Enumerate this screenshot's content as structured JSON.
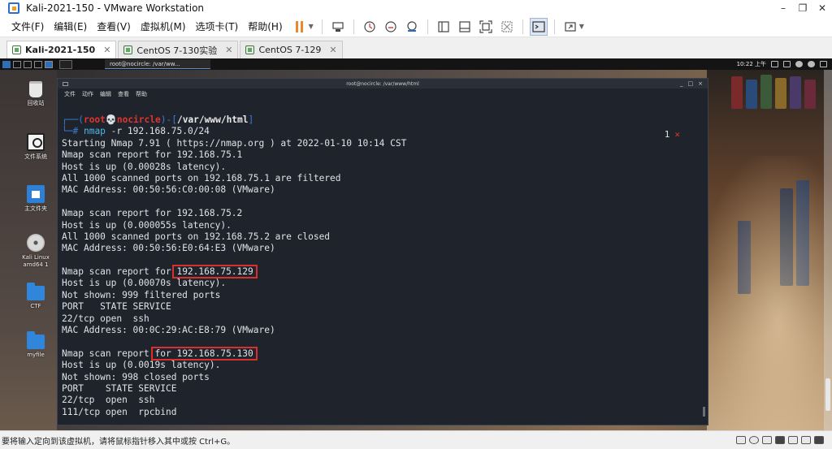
{
  "window": {
    "title": "Kali-2021-150 - VMware Workstation",
    "minimize": "–",
    "restore": "❐",
    "close": "✕"
  },
  "menu": {
    "items": [
      "文件(F)",
      "编辑(E)",
      "查看(V)",
      "虚拟机(M)",
      "选项卡(T)",
      "帮助(H)"
    ]
  },
  "toolbar": {
    "icons": [
      "pause-icon",
      "send-ctrl-alt-del-icon",
      "snapshot-icon",
      "revert-snapshot-icon",
      "snapshot-manager-icon",
      "sidebar-view-icon",
      "thumbnail-view-icon",
      "fit-guest-icon",
      "unity-icon",
      "console-view-icon",
      "fullscreen-icon"
    ]
  },
  "tabs": [
    {
      "label": "Kali-2021-150",
      "active": true,
      "close": "✕"
    },
    {
      "label": "CentOS 7-130实验",
      "active": false,
      "close": "✕"
    },
    {
      "label": "CentOS 7-129",
      "active": false,
      "close": "✕"
    }
  ],
  "kali_panel": {
    "task_label": "root@nocircle: /var/ww...",
    "clock": "10:22 上午"
  },
  "desktop_icons": [
    {
      "label": "回收站",
      "icon": "trash-icon"
    },
    {
      "label": "文件系统",
      "icon": "filesystem-icon"
    },
    {
      "label": "主文件夹",
      "icon": "home-folder-icon"
    },
    {
      "label": "Kali Linux amd64 1",
      "icon": "disc-icon"
    },
    {
      "label": "CTF",
      "icon": "folder-icon"
    },
    {
      "label": "myfile",
      "icon": "folder-icon"
    }
  ],
  "terminal": {
    "title": "root@nocircle: /var/www/html",
    "menu": [
      "文件",
      "动作",
      "编辑",
      "查看",
      "帮助"
    ],
    "prompt": {
      "frame_top": "┌──(",
      "user": "root",
      "skull": "💀",
      "host": "nocircle",
      "mid": ")-[",
      "path": "/var/www/html",
      "end": "]",
      "frame_bottom": "└─",
      "hash": "# ",
      "cmd": "nmap",
      "args": " -r 192.168.75.0/24"
    },
    "exit_code": "1",
    "exit_mark": "✕",
    "output": [
      "Starting Nmap 7.91 ( https://nmap.org ) at 2022-01-10 10:14 CST",
      "Nmap scan report for 192.168.75.1",
      "Host is up (0.00028s latency).",
      "All 1000 scanned ports on 192.168.75.1 are filtered",
      "MAC Address: 00:50:56:C0:00:08 (VMware)",
      "",
      "Nmap scan report for 192.168.75.2",
      "Host is up (0.000055s latency).",
      "All 1000 scanned ports on 192.168.75.2 are closed",
      "MAC Address: 00:50:56:E0:64:E3 (VMware)",
      "",
      "Nmap scan report for ",
      "Host is up (0.00070s latency).",
      "Not shown: 999 filtered ports",
      "PORT   STATE SERVICE",
      "22/tcp open  ssh",
      "MAC Address: 00:0C:29:AC:E8:79 (VMware)",
      "",
      "Nmap scan report ",
      "Host is up (0.0019s latency).",
      "Not shown: 998 closed ports",
      "PORT    STATE SERVICE",
      "22/tcp  open  ssh",
      "111/tcp open  rpcbind"
    ],
    "highlight_1": "192.168.75.129",
    "highlight_2": "for 192.168.75.130"
  },
  "statusbar": {
    "message": "要将输入定向到该虚拟机，请将鼠标指针移入其中或按 Ctrl+G。"
  }
}
